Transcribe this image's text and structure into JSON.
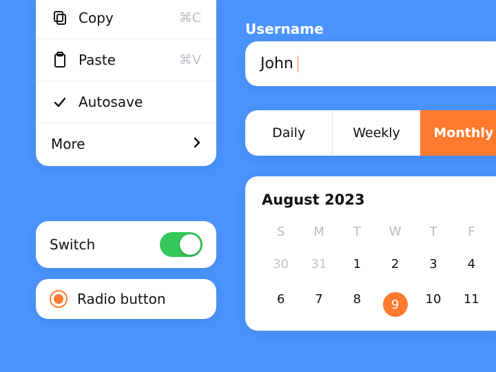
{
  "menu": {
    "copy": {
      "label": "Copy",
      "shortcut": "⌘C"
    },
    "paste": {
      "label": "Paste",
      "shortcut": "⌘V"
    },
    "autosave": {
      "label": "Autosave"
    },
    "more": {
      "label": "More"
    }
  },
  "switch": {
    "label": "Switch",
    "on": true
  },
  "radio": {
    "label": "Radio button",
    "selected": true
  },
  "username": {
    "label": "Username",
    "value": "John"
  },
  "segments": {
    "items": [
      "Daily",
      "Weekly",
      "Monthly"
    ],
    "active": 2
  },
  "calendar": {
    "title": "August 2023",
    "dow": [
      "S",
      "M",
      "T",
      "W",
      "T",
      "F"
    ],
    "rows": [
      [
        {
          "d": "30",
          "dim": true
        },
        {
          "d": "31",
          "dim": true
        },
        {
          "d": "1"
        },
        {
          "d": "2"
        },
        {
          "d": "3"
        },
        {
          "d": "4"
        }
      ],
      [
        {
          "d": "6"
        },
        {
          "d": "7"
        },
        {
          "d": "8"
        },
        {
          "d": "9",
          "sel": true
        },
        {
          "d": "10"
        },
        {
          "d": "11"
        }
      ]
    ]
  },
  "colors": {
    "accent": "#ff7a2f",
    "bg": "#4a94ff",
    "success": "#34c759"
  }
}
